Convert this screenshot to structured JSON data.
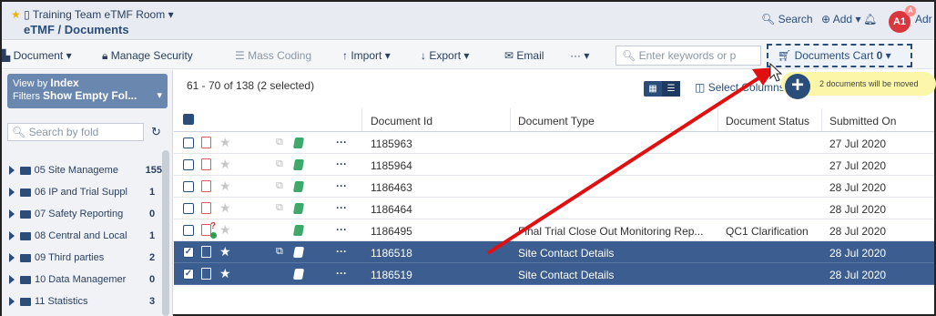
{
  "header": {
    "room": "Training Team eTMF Room",
    "breadcrumb": "eTMF / Documents",
    "search": "Search",
    "add": "Add",
    "avatar": "A1",
    "avatar_sup": "A",
    "user_trunc": "Adr"
  },
  "toolbar": {
    "document": "Document",
    "manage_security": "Manage Security",
    "mass_coding": "Mass Coding",
    "import": "Import",
    "export": "Export",
    "email": "Email",
    "more": "···",
    "search_value": "Enter keywords or p",
    "cart_label": "Documents Cart",
    "cart_count": "0"
  },
  "sidebar": {
    "view_by_label": "View by",
    "view_by_value": "Index",
    "filters_label": "Filters",
    "filters_value": "Show Empty Fol...",
    "folder_search": "Search by fold",
    "items": [
      {
        "name": "05 Site Manageme",
        "count": "155"
      },
      {
        "name": "06 IP and Trial Suppl",
        "count": "1"
      },
      {
        "name": "07 Safety Reporting",
        "count": "0"
      },
      {
        "name": "08 Central and Local",
        "count": "1"
      },
      {
        "name": "09 Third parties",
        "count": "2"
      },
      {
        "name": "10 Data Managemer",
        "count": "0"
      },
      {
        "name": "11 Statistics",
        "count": "3"
      }
    ]
  },
  "main": {
    "count_text": "61 - 70 of 138 (2 selected)",
    "select_columns": "Select Columns",
    "tooltip": "2 documents will be moved",
    "columns": [
      "Document Id",
      "Document Type",
      "Document Status",
      "Submitted On"
    ],
    "rows": [
      {
        "id": "1185963",
        "type": "",
        "status": "",
        "date": "27 Jul 2020"
      },
      {
        "id": "1185964",
        "type": "",
        "status": "",
        "date": "27 Jul 2020"
      },
      {
        "id": "1186463",
        "type": "",
        "status": "",
        "date": "28 Jul 2020"
      },
      {
        "id": "1186464",
        "type": "",
        "status": "",
        "date": "28 Jul 2020"
      },
      {
        "id": "1186495",
        "type": "Final Trial Close Out Monitoring Rep...",
        "status": "QC1 Clarification",
        "date": "28 Jul 2020"
      },
      {
        "id": "1186518",
        "type": "Site Contact Details",
        "status": "",
        "date": "28 Jul 2020"
      },
      {
        "id": "1186519",
        "type": "Site Contact Details",
        "status": "",
        "date": "28 Jul 2020"
      }
    ]
  },
  "colors": {
    "accent": "#2a4d7a",
    "selected_row": "#3c5d8f",
    "arrow": "#e01010",
    "tooltip": "#fbf6a8"
  }
}
